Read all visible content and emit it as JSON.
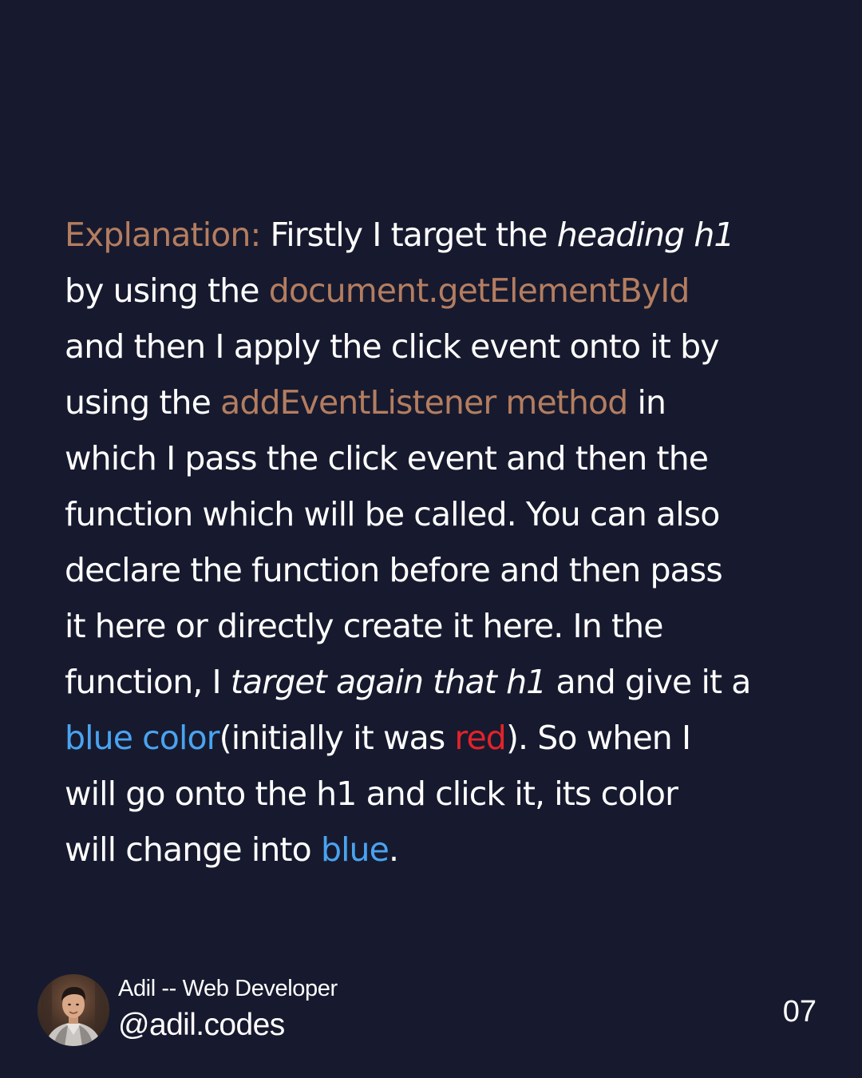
{
  "explanation": {
    "line1": {
      "label": "Explanation:",
      "text1": " Firstly I target the ",
      "italic1": "heading h1"
    },
    "line2": {
      "text1": "by using the ",
      "code1": "document.getElementById"
    },
    "line3": {
      "text1": "and then I apply the click event onto it by"
    },
    "line4": {
      "text1": "using the ",
      "code1": "addEventListener method",
      "text2": " in"
    },
    "line5": {
      "text1": "which I pass the click event and then the"
    },
    "line6": {
      "text1": "function which will be called. You can also"
    },
    "line7": {
      "text1": "declare the function before and then pass"
    },
    "line8": {
      "text1": "it here or directly create it here. In the"
    },
    "line9": {
      "text1": "function, I ",
      "italic1": "target again that h1",
      "text2": " and give it a"
    },
    "line10": {
      "blue1": "blue color",
      "text1": "(initially it was ",
      "red1": "red",
      "text2": "). So when I"
    },
    "line11": {
      "text1": "will go onto the h1 and click it, its color"
    },
    "line12": {
      "text1": "will change into ",
      "blue1": "blue",
      "text2": "."
    }
  },
  "footer": {
    "author_name": "Adil -- Web Developer",
    "author_handle": "@adil.codes",
    "page_number": "07"
  },
  "colors": {
    "background": "#171a2e",
    "text": "#ffffff",
    "accent_orange": "#b47d60",
    "accent_blue": "#4aa3f0",
    "accent_red": "#e2232a"
  },
  "icons": {
    "avatar": "profile-photo"
  }
}
